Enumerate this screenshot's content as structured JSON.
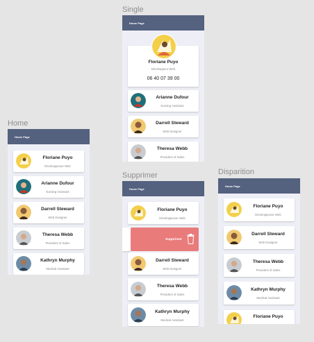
{
  "frames": {
    "home": {
      "label": "Home",
      "appbar_title": "Home Page"
    },
    "single": {
      "label": "Single",
      "appbar_title": "Home Page"
    },
    "supprimer": {
      "label": "Supprimer",
      "appbar_title": "Home Page"
    },
    "disparition": {
      "label": "Disparition",
      "appbar_title": "Home Page"
    }
  },
  "people": [
    {
      "name": "Floriane Puyo",
      "role": "Développeuse Web",
      "avatar": "yellow-illustration-avatar"
    },
    {
      "name": "Arianne Dufour",
      "role": "Nursing Assistant",
      "avatar": "teal-illustration-avatar"
    },
    {
      "name": "Darrell Steward",
      "role": "Web Designer",
      "avatar": "photo-avatar"
    },
    {
      "name": "Theresa Webb",
      "role": "President of Sales",
      "avatar": "photo-avatar"
    },
    {
      "name": "Kathryn Murphy",
      "role": "Medical Assistant",
      "avatar": "photo-avatar"
    }
  ],
  "single_detail": {
    "name": "Floriane Puyo",
    "role": "Développeur Web",
    "phone": "06 40 07 39 00"
  },
  "delete_action": {
    "label": "Supprimer",
    "icon": "trash-icon"
  },
  "colors": {
    "appbar": "#54617f",
    "frame_bg": "#eeeff6",
    "delete_bg": "#e97b7b",
    "canvas_bg": "#e5e5e5"
  }
}
